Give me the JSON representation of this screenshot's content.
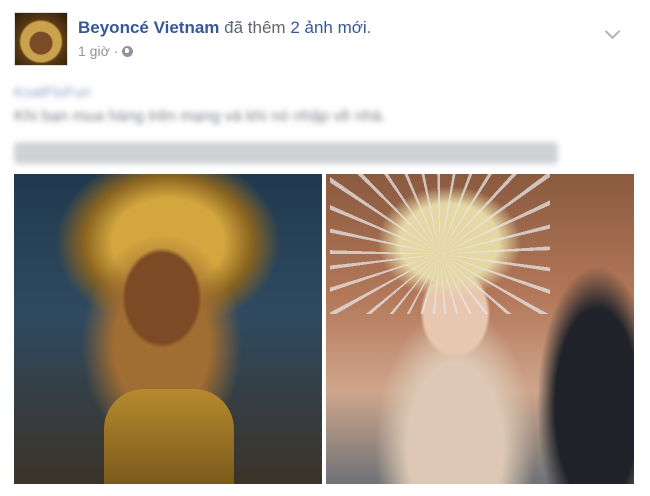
{
  "post": {
    "page_name": "Beyoncé Vietnam",
    "action_text": "đã thêm",
    "photo_count_text": "2 ảnh mới",
    "period": ".",
    "time": "1 giờ",
    "dot": "·",
    "privacy_icon": "globe-icon",
    "menu_icon": "chevron-down-icon",
    "blurred_mention": "KoalFloFun",
    "blurred_body": "Khi bạn mua hàng trên mạng và khi nó nhập về nhà.",
    "photos": [
      {
        "alt": "photo-1"
      },
      {
        "alt": "photo-2"
      }
    ]
  },
  "colors": {
    "link": "#365899",
    "muted": "#90949c",
    "text": "#616770"
  }
}
